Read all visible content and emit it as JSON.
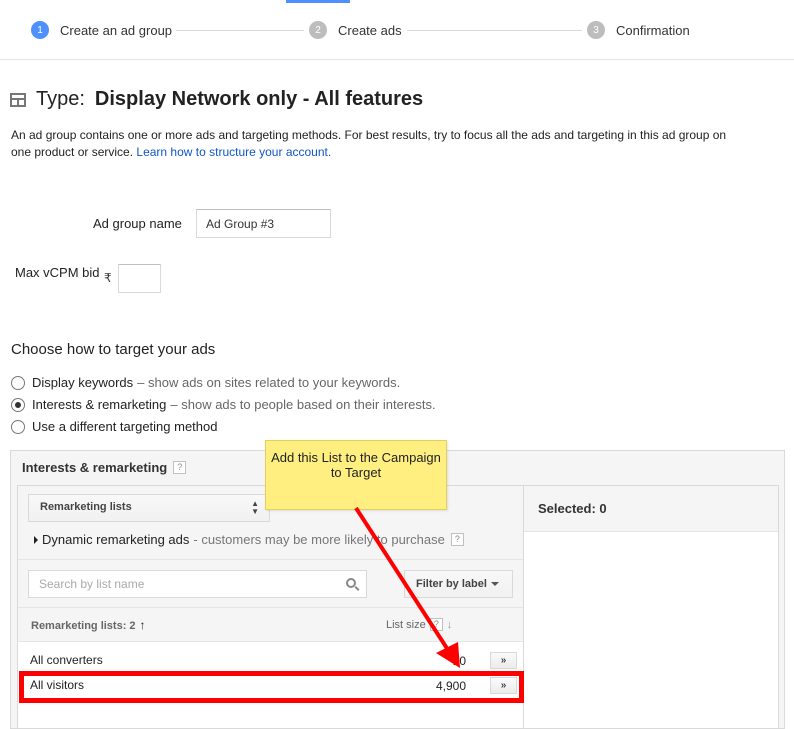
{
  "stepper": {
    "steps": [
      {
        "num": "1",
        "label": "Create an ad group"
      },
      {
        "num": "2",
        "label": "Create ads"
      },
      {
        "num": "3",
        "label": "Confirmation"
      }
    ]
  },
  "header": {
    "type_label": "Type:",
    "type_value": "Display Network only - All features",
    "icon": "layout-icon"
  },
  "intro": {
    "text": "An ad group contains one or more ads and targeting methods. For best results, try to focus all the ads and targeting in this ad group on one product or service. ",
    "link": "Learn how to structure your account."
  },
  "form": {
    "ad_group_name_label": "Ad group name",
    "ad_group_name_value": "Ad Group #3",
    "max_bid_label": "Max vCPM bid",
    "currency_symbol": "₹",
    "max_bid_value": ""
  },
  "targeting": {
    "heading": "Choose how to target your ads",
    "options": [
      {
        "label": "Display keywords",
        "desc": "– show ads on sites related to your keywords.",
        "checked": false
      },
      {
        "label": "Interests & remarketing",
        "desc": "– show ads to people based on their interests.",
        "checked": true
      },
      {
        "label": "Use a different targeting method",
        "desc": "",
        "checked": false
      }
    ]
  },
  "panel": {
    "title": "Interests & remarketing",
    "help": "?",
    "select_value": "Remarketing lists",
    "dynamic_label": "Dynamic remarketing ads",
    "dynamic_desc": "- customers may be more likely to purchase",
    "search_placeholder": "Search by list name",
    "filter_label": "Filter by label",
    "list_header_name": "Remarketing lists: 2",
    "list_header_size": "List size",
    "rows": [
      {
        "name": "All converters",
        "size": "10",
        "add": "»"
      },
      {
        "name": "All visitors",
        "size": "4,900",
        "add": "»"
      }
    ],
    "selected_label": "Selected: 0"
  },
  "callout": {
    "text": "Add this List to the Campaign to Target"
  },
  "colors": {
    "accent": "#4d90fe",
    "highlight": "#ff0000",
    "callout": "#ffef80",
    "link": "#1155cc"
  }
}
